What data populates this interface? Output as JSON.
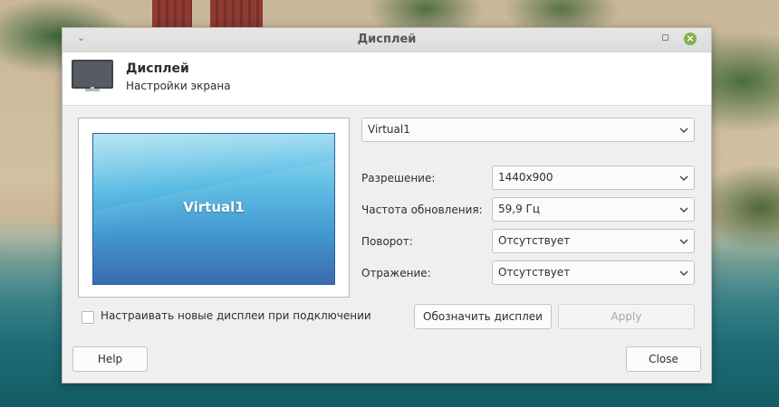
{
  "window": {
    "title": "Дисплей"
  },
  "header": {
    "title": "Дисплей",
    "subtitle": "Настройки экрана",
    "icon": "monitor-icon"
  },
  "preview": {
    "display_label": "Virtual1"
  },
  "output_select": {
    "value": "Virtual1"
  },
  "settings": {
    "resolution": {
      "label": "Разрешение:",
      "value": "1440x900"
    },
    "refresh_rate": {
      "label": "Частота обновления:",
      "value": "59,9 Гц"
    },
    "rotation": {
      "label": "Поворот:",
      "value": "Отсутствует"
    },
    "reflection": {
      "label": "Отражение:",
      "value": "Отсутствует"
    }
  },
  "auto_configure": {
    "label": "Настраивать новые дисплеи при подключении",
    "checked": false
  },
  "buttons": {
    "identify": "Обозначить дисплеи",
    "apply": "Apply",
    "help": "Help",
    "close": "Close"
  },
  "colors": {
    "close_button_accent": "#82b04a",
    "preview_gradient_top": "#9fdcf0",
    "preview_gradient_bottom": "#2b5ea7"
  }
}
